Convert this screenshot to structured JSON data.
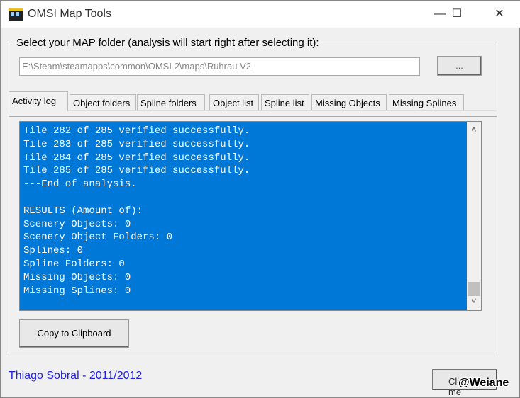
{
  "window": {
    "title": "OMSI Map Tools",
    "minimize": "—",
    "maximize": "☐",
    "close": "✕"
  },
  "folder": {
    "label": "Select your MAP folder (analysis will start right after selecting it):",
    "path": "E:\\Steam\\steamapps\\common\\OMSI 2\\maps\\Ruhrau V2",
    "browse": "..."
  },
  "tabs": [
    {
      "label": "Activity log"
    },
    {
      "label": "Object folders"
    },
    {
      "label": "Spline folders"
    },
    {
      "label": "Object list"
    },
    {
      "label": "Spline list"
    },
    {
      "label": "Missing Objects"
    },
    {
      "label": "Missing Splines"
    }
  ],
  "log": {
    "lines": [
      "Tile 282 of 285 verified successfully.",
      "Tile 283 of 285 verified successfully.",
      "Tile 284 of 285 verified successfully.",
      "Tile 285 of 285 verified successfully.",
      "---End of analysis.",
      "",
      "RESULTS (Amount of):",
      "Scenery Objects: 0",
      "Scenery Object Folders: 0",
      "Splines: 0",
      "Spline Folders: 0",
      "Missing Objects: 0",
      "Missing Splines: 0"
    ],
    "scroll_up": "˄",
    "scroll_down": "˅"
  },
  "copy_button": "Copy to Clipboard",
  "credit": "Thiago Sobral - 2011/2012",
  "close_button": "Click me",
  "watermark": "@Weiane",
  "colors": {
    "log_bg": "#0078d7",
    "credit": "#2020e0"
  }
}
